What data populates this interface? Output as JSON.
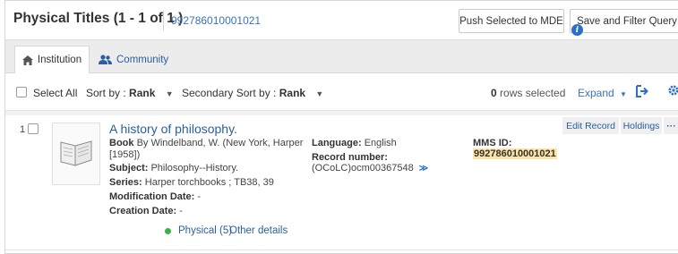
{
  "header": {
    "title": "Physical Titles (1 - 1 of 1 )",
    "mms_link": "992786010001021",
    "push_button": "Push Selected to MDE",
    "save_button": "Save and Filter Query",
    "info_icon": "info-icon"
  },
  "tabs": [
    {
      "label": "Institution",
      "icon": "home-icon",
      "active": true
    },
    {
      "label": "Community",
      "icon": "users-icon",
      "active": false
    }
  ],
  "toolbar": {
    "select_all": "Select All",
    "sort_prefix": "Sort by :",
    "sort_value": "Rank",
    "secondary_prefix": "Secondary Sort by :",
    "secondary_value": "Rank",
    "rows_count": "0",
    "rows_suffix": "rows selected",
    "expand": "Expand",
    "export_icon": "export-icon",
    "settings_icon": "gear-icon"
  },
  "record": {
    "index": "1",
    "title": "A history of philosophy.",
    "type": "Book",
    "author_line1": "By Windelband, W. (New York, Harper",
    "author_line2": "[1958])",
    "subject_label": "Subject:",
    "subject": "Philosophy--History.",
    "series_label": "Series:",
    "series": "Harper torchbooks ; TB38, 39",
    "modification_label": "Modification Date:",
    "modification": "-",
    "creation_label": "Creation Date:",
    "creation": "-",
    "language_label": "Language:",
    "language": "English",
    "record_number_label": "Record number:",
    "record_number": "(OCoLC)ocm00367548",
    "mms_label": "MMS ID:",
    "mms_id": "992786010001021",
    "edit_button": "Edit Record",
    "holdings_button": "Holdings",
    "more_button": "···",
    "physical_link": "Physical (5)",
    "other_details": "Other details",
    "status_color": "#3cb043"
  }
}
